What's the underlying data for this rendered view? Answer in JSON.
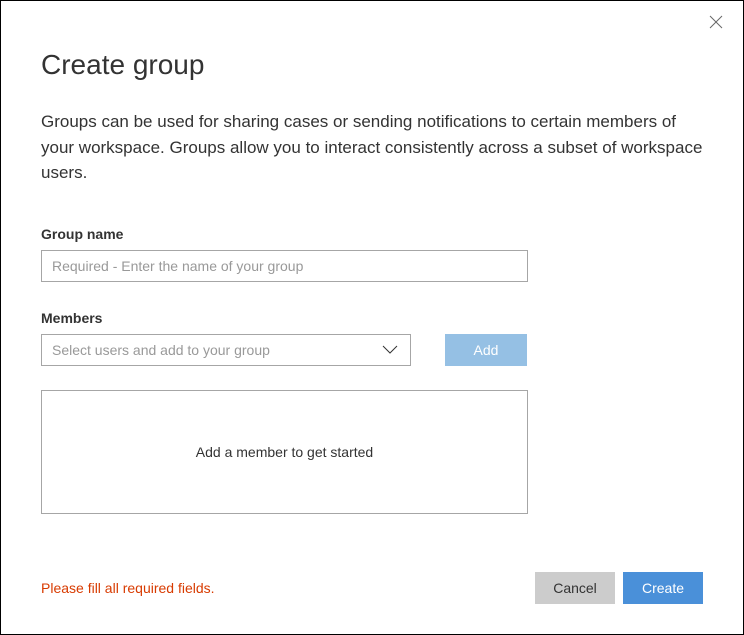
{
  "header": {
    "title": "Create group"
  },
  "description": "Groups can be used for sharing cases or sending notifications to certain members of your workspace. Groups allow you to interact consistently across a subset of workspace users.",
  "fields": {
    "groupName": {
      "label": "Group name",
      "placeholder": "Required - Enter the name of your group",
      "value": ""
    },
    "members": {
      "label": "Members",
      "selectPlaceholder": "Select users and add to your group",
      "addButton": "Add",
      "emptyState": "Add a member to get started"
    }
  },
  "footer": {
    "errorMessage": "Please fill all required fields.",
    "cancelButton": "Cancel",
    "createButton": "Create"
  }
}
